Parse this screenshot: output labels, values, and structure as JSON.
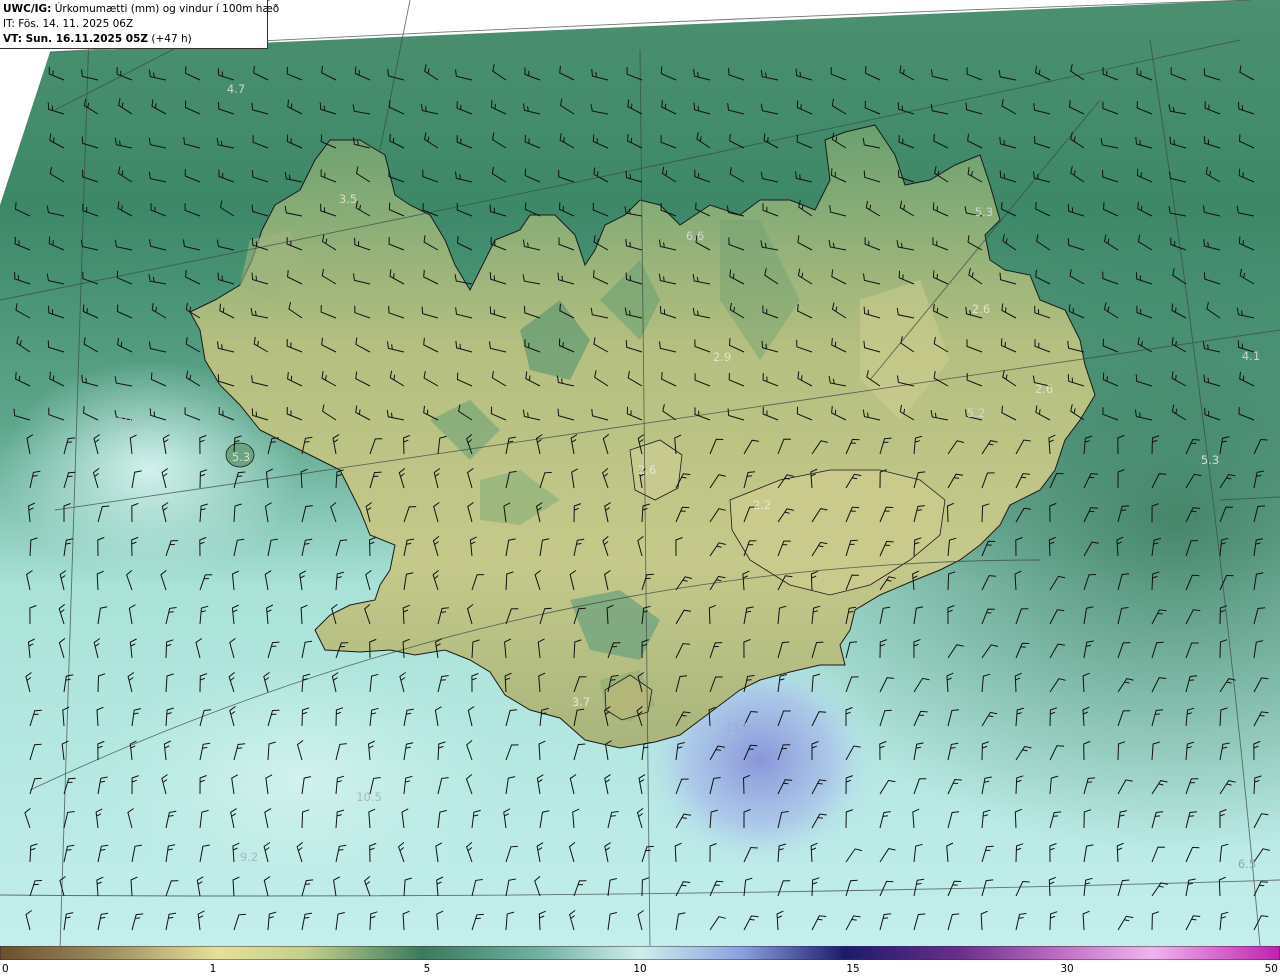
{
  "header": {
    "model_prefix": "UWC/IG:",
    "title": " Úrkomumætti (mm) og vindur í 100m hæð",
    "init_time": "IT: Fös. 14. 11. 2025 06Z",
    "valid_prefix": "VT: Sun. 16.11.2025 05Z",
    "valid_suffix": " (+47 h)"
  },
  "colorbar": {
    "ticks": [
      "0",
      "1",
      "5",
      "10",
      "15",
      "30",
      "50"
    ],
    "colors": [
      "#6d4e2e",
      "#9a8a5c",
      "#c2b870",
      "#e6e09a",
      "#b8c47c",
      "#6f9a6c",
      "#3b7a5e",
      "#2f7a6a",
      "#5fa89a",
      "#a6dcd4",
      "#cfeeed",
      "#9fc2e8",
      "#7a8fd8",
      "#4a4aa8",
      "#1c1a6e",
      "#5a2a8a",
      "#b060b8",
      "#e6a0e0",
      "#f0a6ec",
      "#c83cb8"
    ]
  },
  "map": {
    "land_color": "#c3c884",
    "land_dark_color": "#7fa06a",
    "sea_north_color": "#3f8a6a",
    "sea_south_color": "#b9ece8",
    "sea_max_color": "#8ea0dc",
    "values": [
      {
        "id": "v1",
        "text": "4.7"
      },
      {
        "id": "v2",
        "text": "3.5"
      },
      {
        "id": "v3",
        "text": "6.6"
      },
      {
        "id": "v4",
        "text": "5.3"
      },
      {
        "id": "v5",
        "text": "2.6"
      },
      {
        "id": "v6",
        "text": "4.1"
      },
      {
        "id": "v7",
        "text": "2.9"
      },
      {
        "id": "v8",
        "text": "2.6"
      },
      {
        "id": "v9",
        "text": "5.2"
      },
      {
        "id": "v10",
        "text": "10.6"
      },
      {
        "id": "v11",
        "text": "5.3"
      },
      {
        "id": "v12",
        "text": "2.6"
      },
      {
        "id": "v13",
        "text": "2.2"
      },
      {
        "id": "v14",
        "text": "5.3"
      },
      {
        "id": "v15",
        "text": "3.7"
      },
      {
        "id": "v16",
        "text": "11.9"
      },
      {
        "id": "v17",
        "text": "10.5"
      },
      {
        "id": "v18",
        "text": "9.2"
      },
      {
        "id": "v19",
        "text": "6.5"
      }
    ]
  }
}
